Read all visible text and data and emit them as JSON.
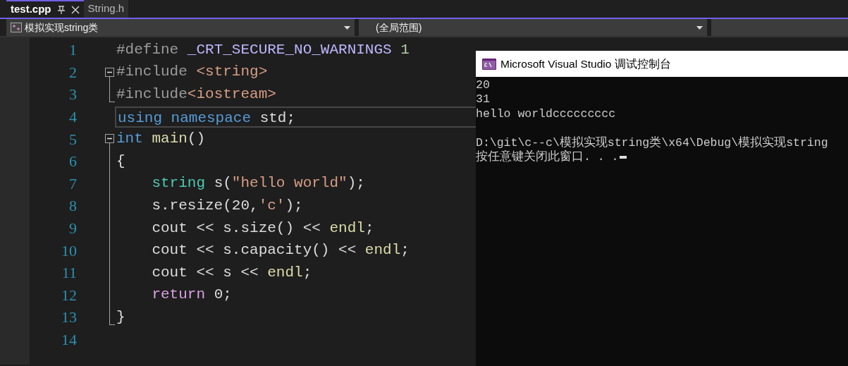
{
  "tabs": [
    {
      "label": "test.cpp",
      "selected": true,
      "pinned": true
    },
    {
      "label": "String.h",
      "selected": false,
      "pinned": false
    }
  ],
  "dropdowns": [
    {
      "label": "模拟实现string类",
      "kind": "project"
    },
    {
      "label": "(全局范围)",
      "kind": "scope"
    }
  ],
  "code_lines": [
    {
      "number": "1",
      "kind": "plain",
      "current": false,
      "tokens": [
        {
          "t": "#define ",
          "kind": "preprocessor"
        },
        {
          "t": "_CRT_SECURE_NO_WARNINGS",
          "kind": "macro"
        },
        {
          "t": " 1",
          "kind": "number"
        }
      ]
    },
    {
      "number": "2",
      "kind": "foldstart",
      "current": false,
      "tokens": [
        {
          "t": "#include ",
          "kind": "preprocessor"
        },
        {
          "t": "<string>",
          "kind": "string"
        }
      ]
    },
    {
      "number": "3",
      "kind": "foldend",
      "current": false,
      "tokens": [
        {
          "t": "#include",
          "kind": "preprocessor"
        },
        {
          "t": "<iostream>",
          "kind": "string"
        }
      ]
    },
    {
      "number": "4",
      "kind": "plain",
      "current": true,
      "tokens": [
        {
          "t": "using namespace",
          "kind": "keyword"
        },
        {
          "t": " std;",
          "kind": "plain"
        }
      ]
    },
    {
      "number": "5",
      "kind": "foldstart",
      "current": false,
      "tokens": [
        {
          "t": "int ",
          "kind": "keyword"
        },
        {
          "t": "main",
          "kind": "function"
        },
        {
          "t": "()",
          "kind": "plain"
        }
      ]
    },
    {
      "number": "6",
      "kind": "foldbody",
      "current": false,
      "tokens": [
        {
          "t": "{",
          "kind": "plain"
        }
      ]
    },
    {
      "number": "7",
      "kind": "foldbody",
      "current": false,
      "tokens": [
        {
          "t": "    string",
          "kind": "type"
        },
        {
          "t": " s(",
          "kind": "plain"
        },
        {
          "t": "\"hello world\"",
          "kind": "string"
        },
        {
          "t": ");",
          "kind": "plain"
        }
      ]
    },
    {
      "number": "8",
      "kind": "foldbody",
      "current": false,
      "tokens": [
        {
          "t": "    s.resize(20,",
          "kind": "plain"
        },
        {
          "t": "'c'",
          "kind": "string"
        },
        {
          "t": ");",
          "kind": "plain"
        }
      ]
    },
    {
      "number": "9",
      "kind": "foldbody",
      "current": false,
      "tokens": [
        {
          "t": "    cout << s.size() << ",
          "kind": "plain"
        },
        {
          "t": "endl",
          "kind": "function"
        },
        {
          "t": ";",
          "kind": "plain"
        }
      ]
    },
    {
      "number": "10",
      "kind": "foldbody",
      "current": false,
      "tokens": [
        {
          "t": "    cout << s.capacity() << ",
          "kind": "plain"
        },
        {
          "t": "endl",
          "kind": "function"
        },
        {
          "t": ";",
          "kind": "plain"
        }
      ]
    },
    {
      "number": "11",
      "kind": "foldbody",
      "current": false,
      "tokens": [
        {
          "t": "    cout << s << ",
          "kind": "plain"
        },
        {
          "t": "endl",
          "kind": "function"
        },
        {
          "t": ";",
          "kind": "plain"
        }
      ]
    },
    {
      "number": "12",
      "kind": "foldbody",
      "current": false,
      "tokens": [
        {
          "t": "    return",
          "kind": "control"
        },
        {
          "t": " 0;",
          "kind": "plain"
        }
      ]
    },
    {
      "number": "13",
      "kind": "foldend",
      "current": false,
      "tokens": [
        {
          "t": "}",
          "kind": "plain"
        }
      ]
    },
    {
      "number": "14",
      "kind": "plain",
      "current": false
    }
  ],
  "console": {
    "title": "Microsoft Visual Studio 调试控制台",
    "lines": [
      {
        "text": "20"
      },
      {
        "text": "31"
      },
      {
        "text": "hello worldccccccccc"
      },
      {
        "text": "D:\\git\\c--c\\模拟实现string类\\x64\\Debug\\模拟实现string",
        "gap_before": true
      },
      {
        "text": "按任意键关闭此窗口. . ."
      }
    ],
    "cursor": true
  }
}
